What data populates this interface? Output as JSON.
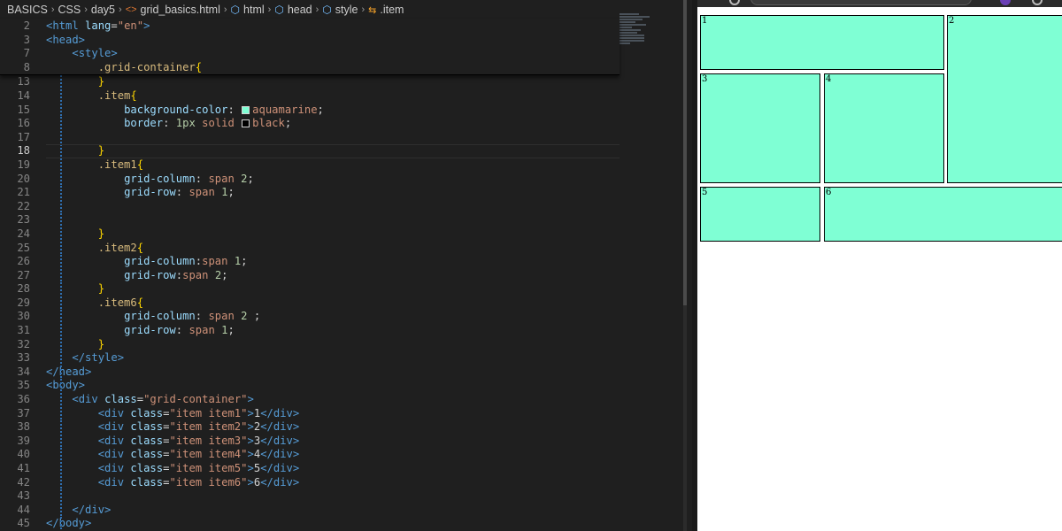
{
  "breadcrumb": {
    "items": [
      "BASICS",
      "CSS",
      "day5",
      "grid_basics.html",
      "html",
      "head",
      "style",
      ".item"
    ]
  },
  "code": {
    "sticky_lines": [
      {
        "n": "2",
        "html": "<span class=\"t-tag\">&lt;html</span> <span class=\"t-attr\">lang</span>=<span class=\"t-str\">\"en\"</span><span class=\"t-tag\">&gt;</span>",
        "indent": 0
      },
      {
        "n": "3",
        "html": "<span class=\"t-tag\">&lt;head&gt;</span>",
        "indent": 0
      },
      {
        "n": "7",
        "html": "    <span class=\"t-tag\">&lt;style&gt;</span>",
        "indent": 0
      },
      {
        "n": "8",
        "html": "        <span class=\"t-sel\">.grid-container</span><span class=\"t-br\">{</span>",
        "indent": 0
      }
    ],
    "lines": [
      {
        "n": "13",
        "html": "        <span class=\"t-br\">}</span>"
      },
      {
        "n": "14",
        "html": "        <span class=\"t-sel\">.item</span><span class=\"t-br\">{</span>"
      },
      {
        "n": "15",
        "html": "            <span class=\"t-prop\">background-color</span>: <span class=\"swatch\" style=\"background:#7fffd4\"></span><span class=\"t-val\">aquamarine</span>;"
      },
      {
        "n": "16",
        "html": "            <span class=\"t-prop\">border</span>: <span class=\"t-num\">1px</span> <span class=\"t-val\">solid</span> <span class=\"swatch\" style=\"background:#000\"></span><span class=\"t-val\">black</span>;"
      },
      {
        "n": "17",
        "html": ""
      },
      {
        "n": "18",
        "html": "        <span class=\"t-br\">}</span>",
        "active": true
      },
      {
        "n": "19",
        "html": "        <span class=\"t-sel\">.item1</span><span class=\"t-br\">{</span>"
      },
      {
        "n": "20",
        "html": "            <span class=\"t-prop\">grid-column</span>: <span class=\"t-val\">span</span> <span class=\"t-num\">2</span>;"
      },
      {
        "n": "21",
        "html": "            <span class=\"t-prop\">grid-row</span>: <span class=\"t-val\">span</span> <span class=\"t-num\">1</span>;"
      },
      {
        "n": "22",
        "html": ""
      },
      {
        "n": "23",
        "html": ""
      },
      {
        "n": "24",
        "html": "        <span class=\"t-br\">}</span>"
      },
      {
        "n": "25",
        "html": "        <span class=\"t-sel\">.item2</span><span class=\"t-br\">{</span>"
      },
      {
        "n": "26",
        "html": "            <span class=\"t-prop\">grid-column</span>:<span class=\"t-val\">span</span> <span class=\"t-num\">1</span>;"
      },
      {
        "n": "27",
        "html": "            <span class=\"t-prop\">grid-row</span>:<span class=\"t-val\">span</span> <span class=\"t-num\">2</span>;"
      },
      {
        "n": "28",
        "html": "        <span class=\"t-br\">}</span>"
      },
      {
        "n": "29",
        "html": "        <span class=\"t-sel\">.item6</span><span class=\"t-br\">{</span>"
      },
      {
        "n": "30",
        "html": "            <span class=\"t-prop\">grid-column</span>: <span class=\"t-val\">span</span> <span class=\"t-num\">2</span> ;"
      },
      {
        "n": "31",
        "html": "            <span class=\"t-prop\">grid-row</span>: <span class=\"t-val\">span</span> <span class=\"t-num\">1</span>;"
      },
      {
        "n": "32",
        "html": "        <span class=\"t-br\">}</span>"
      },
      {
        "n": "33",
        "html": "    <span class=\"t-tag\">&lt;/style&gt;</span>"
      },
      {
        "n": "34",
        "html": "<span class=\"t-tag\">&lt;/head&gt;</span>"
      },
      {
        "n": "35",
        "html": "<span class=\"t-tag\">&lt;body&gt;</span>"
      },
      {
        "n": "36",
        "html": "    <span class=\"t-tag\">&lt;div</span> <span class=\"t-attr\">class</span>=<span class=\"t-str\">\"grid-container\"</span><span class=\"t-tag\">&gt;</span>"
      },
      {
        "n": "37",
        "html": "        <span class=\"t-tag\">&lt;div</span> <span class=\"t-attr\">class</span>=<span class=\"t-str\">\"item item1\"</span><span class=\"t-tag\">&gt;</span><span class=\"t-txt\">1</span><span class=\"t-tag\">&lt;/div&gt;</span>"
      },
      {
        "n": "38",
        "html": "        <span class=\"t-tag\">&lt;div</span> <span class=\"t-attr\">class</span>=<span class=\"t-str\">\"item item2\"</span><span class=\"t-tag\">&gt;</span><span class=\"t-txt\">2</span><span class=\"t-tag\">&lt;/div&gt;</span>"
      },
      {
        "n": "39",
        "html": "        <span class=\"t-tag\">&lt;div</span> <span class=\"t-attr\">class</span>=<span class=\"t-str\">\"item item3\"</span><span class=\"t-tag\">&gt;</span><span class=\"t-txt\">3</span><span class=\"t-tag\">&lt;/div&gt;</span>"
      },
      {
        "n": "40",
        "html": "        <span class=\"t-tag\">&lt;div</span> <span class=\"t-attr\">class</span>=<span class=\"t-str\">\"item item4\"</span><span class=\"t-tag\">&gt;</span><span class=\"t-txt\">4</span><span class=\"t-tag\">&lt;/div&gt;</span>"
      },
      {
        "n": "41",
        "html": "        <span class=\"t-tag\">&lt;div</span> <span class=\"t-attr\">class</span>=<span class=\"t-str\">\"item item5\"</span><span class=\"t-tag\">&gt;</span><span class=\"t-txt\">5</span><span class=\"t-tag\">&lt;/div&gt;</span>"
      },
      {
        "n": "42",
        "html": "        <span class=\"t-tag\">&lt;div</span> <span class=\"t-attr\">class</span>=<span class=\"t-str\">\"item item6\"</span><span class=\"t-tag\">&gt;</span><span class=\"t-txt\">6</span><span class=\"t-tag\">&lt;/div&gt;</span>"
      },
      {
        "n": "43",
        "html": ""
      },
      {
        "n": "44",
        "html": "    <span class=\"t-tag\">&lt;/div&gt;</span>"
      },
      {
        "n": "45",
        "html": "<span class=\"t-tag\">&lt;/body&gt;</span>"
      }
    ]
  },
  "preview": {
    "items": [
      {
        "label": "1"
      },
      {
        "label": "2"
      },
      {
        "label": "3"
      },
      {
        "label": "4"
      },
      {
        "label": "5"
      },
      {
        "label": "6"
      }
    ]
  },
  "colors": {
    "item_bg": "#7fffd4",
    "editor_bg": "#1f1f1f"
  }
}
